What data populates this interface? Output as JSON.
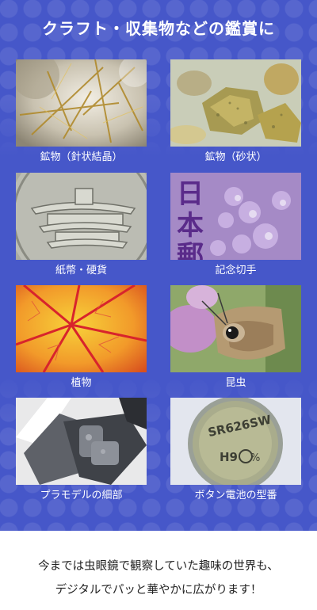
{
  "header": {
    "title": "クラフト・収集物などの鑑賞に"
  },
  "items": [
    {
      "label": "鉱物（針状結晶）",
      "icon": "rutile-quartz-photo"
    },
    {
      "label": "鉱物（砂状）",
      "icon": "mineral-sand-photo"
    },
    {
      "label": "紙幣・硬貨",
      "icon": "coin-temple-photo"
    },
    {
      "label": "記念切手",
      "icon": "stamp-photo"
    },
    {
      "label": "植物",
      "icon": "leaf-veins-photo"
    },
    {
      "label": "昆虫",
      "icon": "butterfly-photo"
    },
    {
      "label": "プラモデルの細部",
      "icon": "plastic-model-photo"
    },
    {
      "label": "ボタン電池の型番",
      "icon": "button-battery-photo"
    }
  ],
  "battery": {
    "model": "SR626SW",
    "code": "H9",
    "suffix": "%"
  },
  "stamp": {
    "chars": "日本郵"
  },
  "caption": {
    "line1": "今までは虫眼鏡で観察していた趣味の世界も、",
    "line2": "デジタルでパッと華やかに広がります！"
  },
  "colors": {
    "panel": "#4657c9",
    "text_dark": "#222222"
  }
}
